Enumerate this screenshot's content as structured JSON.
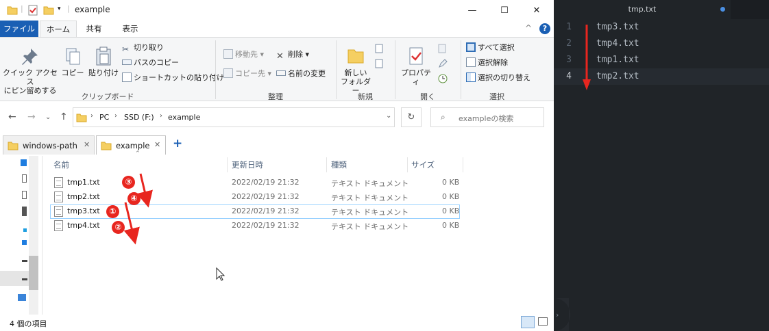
{
  "explorer": {
    "window_title": "example",
    "window_controls": {
      "minimize": "—",
      "maximize": "☐",
      "close": "✕"
    },
    "ribbon_tabs": [
      "ファイル",
      "ホーム",
      "共有",
      "表示"
    ],
    "ribbon_help": "?",
    "ribbon_collapse": "^",
    "clipboard": {
      "pin_label_line1": "クイック アクセス",
      "pin_label_line2": "にピン留めする",
      "copy_label": "コピー",
      "paste_label": "貼り付け",
      "cut_label": "切り取り",
      "copy_path_label": "パスのコピー",
      "paste_shortcut_label": "ショートカットの貼り付け",
      "group_label": "クリップボード"
    },
    "organize": {
      "move_to_label": "移動先",
      "copy_to_label": "コピー先",
      "delete_label": "削除",
      "rename_label": "名前の変更",
      "group_label": "整理"
    },
    "new": {
      "new_folder_line1": "新しい",
      "new_folder_line2": "フォルダー",
      "group_label": "新規"
    },
    "open": {
      "properties_label": "プロパティ",
      "group_label": "開く"
    },
    "select": {
      "select_all_label": "すべて選択",
      "select_none_label": "選択解除",
      "invert_label": "選択の切り替え",
      "group_label": "選択"
    },
    "address": {
      "segments": [
        "PC",
        "SSD (F:)",
        "example"
      ],
      "search_placeholder": "exampleの検索"
    },
    "folder_tabs": [
      {
        "label": "windows-path"
      },
      {
        "label": "example"
      }
    ],
    "new_tab_label": "+",
    "columns": [
      "名前",
      "更新日時",
      "種類",
      "サイズ"
    ],
    "files": [
      {
        "name": "tmp1.txt",
        "modified": "2022/02/19 21:32",
        "type": "テキスト ドキュメント",
        "size": "0 KB"
      },
      {
        "name": "tmp2.txt",
        "modified": "2022/02/19 21:32",
        "type": "テキスト ドキュメント",
        "size": "0 KB"
      },
      {
        "name": "tmp3.txt",
        "modified": "2022/02/19 21:32",
        "type": "テキスト ドキュメント",
        "size": "0 KB"
      },
      {
        "name": "tmp4.txt",
        "modified": "2022/02/19 21:32",
        "type": "テキスト ドキュメント",
        "size": "0 KB"
      }
    ],
    "status_text": "4 個の項目",
    "annotation_badges": [
      "③",
      "④",
      "①",
      "②"
    ],
    "annotation_color": "#e8261f"
  },
  "editor": {
    "tab_title": "tmp.txt",
    "lines": [
      {
        "number": "1",
        "text": "tmp3.txt"
      },
      {
        "number": "2",
        "text": "tmp4.txt"
      },
      {
        "number": "3",
        "text": "tmp1.txt"
      },
      {
        "number": "4",
        "text": "tmp2.txt"
      }
    ],
    "background_color": "#202428",
    "arrow_color": "#e8261f"
  }
}
